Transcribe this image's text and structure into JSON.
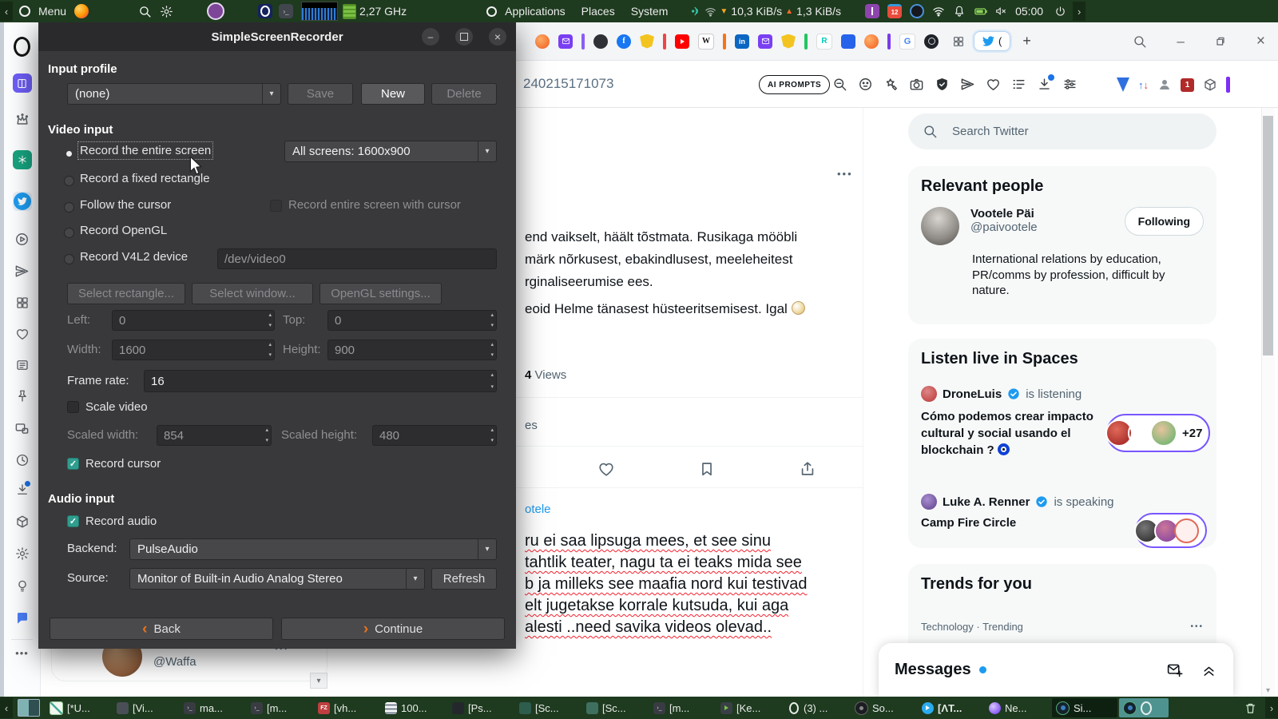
{
  "panel": {
    "menu": "Menu",
    "cpu_freq": "2,27 GHz",
    "applications": "Applications",
    "places": "Places",
    "system": "System",
    "net_down": "10,3 KiB/s",
    "net_up": "1,3 KiB/s",
    "clock": "05:00"
  },
  "icons": {
    "chev_left": "‹",
    "chev_right": "›",
    "caret_down": "▾",
    "caret_up": "▴",
    "down_arrow": "▼",
    "up_arrow": "▲",
    "plus": "+",
    "close": "×",
    "minimize": "–",
    "dots_h": "•••"
  },
  "browser": {
    "url_fragment": "240215171073",
    "ai_prompts": "AI PROMPTS",
    "active_tab_fragment": "(",
    "favicons": {
      "facebook": "f",
      "wikipedia": "W",
      "linkedin": "in",
      "researchgate": "R",
      "google": "G"
    }
  },
  "twitter": {
    "search_placeholder": "Search Twitter",
    "tweet_lines": [
      "end vaikselt, häält tõstmata. Rusikaga mööbli",
      "märk nõrkusest, ebakindlusest, meeleheitest",
      "rginaliseerumise ees.",
      "eoid Helme tänasest hüsteeritsemisest. Igal"
    ],
    "views_count": "4",
    "views_label": "Views",
    "stats_fragment": "es",
    "replyto_fragment": "otele",
    "reply_lines": [
      "ru ei saa lipsuga mees, et see sinu",
      "tahtlik teater, nagu ta ei teaks mida see",
      "b ja milleks see maafia nord kui testivad",
      "elt jugetakse korrale kutsuda, kui aga",
      "alesti ..need savika videos olevad.."
    ],
    "account_handle": "@Waffa",
    "relevant_people": {
      "title": "Relevant people",
      "name": "Vootele Päi",
      "handle": "@paivootele",
      "follow_state": "Following",
      "bio": "International relations by education, PR/comms by profession, difficult by nature."
    },
    "spaces": {
      "title": "Listen live in Spaces",
      "item1": {
        "host": "DroneLuis",
        "status": "is listening",
        "space_title": "Cómo podemos crear impacto cultural y social usando el blockchain ?",
        "more_count": "+27"
      },
      "item2": {
        "host": "Luke A. Renner",
        "status": "is speaking",
        "space_title": "Camp Fire Circle"
      }
    },
    "trends": {
      "title": "Trends for you",
      "item_category": "Technology · Trending"
    },
    "messages": {
      "title": "Messages"
    }
  },
  "dialog": {
    "title": "SimpleScreenRecorder",
    "profile_heading": "Input profile",
    "profile_value": "(none)",
    "save": "Save",
    "new_btn": "New",
    "delete_btn": "Delete",
    "video_heading": "Video input",
    "record_entire": "Record the entire screen",
    "screens_value": "All screens: 1600x900",
    "record_rect": "Record a fixed rectangle",
    "follow_cursor": "Follow the cursor",
    "with_cursor": "Record entire screen with cursor",
    "record_opengl": "Record OpenGL",
    "record_v4l2": "Record V4L2 device",
    "v4l2_value": "/dev/video0",
    "select_rect": "Select rectangle...",
    "select_window": "Select window...",
    "opengl_settings": "OpenGL settings...",
    "left_label": "Left:",
    "left_value": "0",
    "top_label": "Top:",
    "top_value": "0",
    "width_label": "Width:",
    "width_value": "1600",
    "height_label": "Height:",
    "height_value": "900",
    "framerate_label": "Frame rate:",
    "framerate_value": "16",
    "scale_video": "Scale video",
    "sc_width_label": "Scaled width:",
    "sc_width_value": "854",
    "sc_height_label": "Scaled height:",
    "sc_height_value": "480",
    "record_cursor": "Record cursor",
    "audio_heading": "Audio input",
    "record_audio": "Record audio",
    "backend_label": "Backend:",
    "backend_value": "PulseAudio",
    "source_label": "Source:",
    "source_value": "Monitor of Built-in Audio Analog Stereo",
    "refresh": "Refresh",
    "back": "Back",
    "continue_btn": "Continue"
  },
  "taskbar": {
    "items": [
      {
        "label": "[*U..."
      },
      {
        "label": "[Vi..."
      },
      {
        "label": "ma..."
      },
      {
        "label": "[m..."
      },
      {
        "label": "[vh..."
      },
      {
        "label": "100..."
      },
      {
        "label": "[Ps..."
      },
      {
        "label": "[Sc..."
      },
      {
        "label": "[Sc..."
      },
      {
        "label": "[m..."
      },
      {
        "label": "[Ke..."
      },
      {
        "label": "(3) ..."
      },
      {
        "label": "So..."
      },
      {
        "label": "[ΛT..."
      },
      {
        "label": "Ne..."
      },
      {
        "label": "Si..."
      }
    ]
  }
}
